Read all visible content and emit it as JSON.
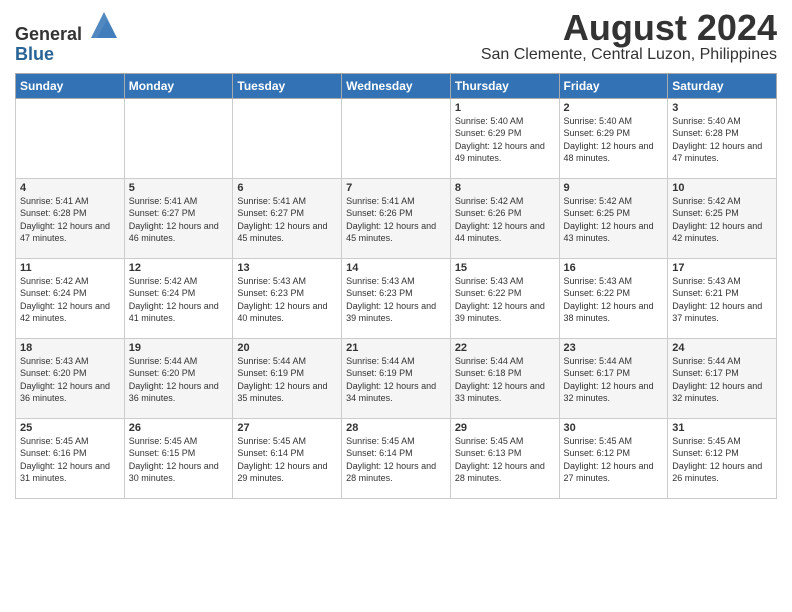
{
  "logo": {
    "general": "General",
    "blue": "Blue"
  },
  "title": {
    "month_year": "August 2024",
    "location": "San Clemente, Central Luzon, Philippines"
  },
  "headers": [
    "Sunday",
    "Monday",
    "Tuesday",
    "Wednesday",
    "Thursday",
    "Friday",
    "Saturday"
  ],
  "weeks": [
    [
      {
        "day": "",
        "sunrise": "",
        "sunset": "",
        "daylight": ""
      },
      {
        "day": "",
        "sunrise": "",
        "sunset": "",
        "daylight": ""
      },
      {
        "day": "",
        "sunrise": "",
        "sunset": "",
        "daylight": ""
      },
      {
        "day": "",
        "sunrise": "",
        "sunset": "",
        "daylight": ""
      },
      {
        "day": "1",
        "sunrise": "Sunrise: 5:40 AM",
        "sunset": "Sunset: 6:29 PM",
        "daylight": "Daylight: 12 hours and 49 minutes."
      },
      {
        "day": "2",
        "sunrise": "Sunrise: 5:40 AM",
        "sunset": "Sunset: 6:29 PM",
        "daylight": "Daylight: 12 hours and 48 minutes."
      },
      {
        "day": "3",
        "sunrise": "Sunrise: 5:40 AM",
        "sunset": "Sunset: 6:28 PM",
        "daylight": "Daylight: 12 hours and 47 minutes."
      }
    ],
    [
      {
        "day": "4",
        "sunrise": "Sunrise: 5:41 AM",
        "sunset": "Sunset: 6:28 PM",
        "daylight": "Daylight: 12 hours and 47 minutes."
      },
      {
        "day": "5",
        "sunrise": "Sunrise: 5:41 AM",
        "sunset": "Sunset: 6:27 PM",
        "daylight": "Daylight: 12 hours and 46 minutes."
      },
      {
        "day": "6",
        "sunrise": "Sunrise: 5:41 AM",
        "sunset": "Sunset: 6:27 PM",
        "daylight": "Daylight: 12 hours and 45 minutes."
      },
      {
        "day": "7",
        "sunrise": "Sunrise: 5:41 AM",
        "sunset": "Sunset: 6:26 PM",
        "daylight": "Daylight: 12 hours and 45 minutes."
      },
      {
        "day": "8",
        "sunrise": "Sunrise: 5:42 AM",
        "sunset": "Sunset: 6:26 PM",
        "daylight": "Daylight: 12 hours and 44 minutes."
      },
      {
        "day": "9",
        "sunrise": "Sunrise: 5:42 AM",
        "sunset": "Sunset: 6:25 PM",
        "daylight": "Daylight: 12 hours and 43 minutes."
      },
      {
        "day": "10",
        "sunrise": "Sunrise: 5:42 AM",
        "sunset": "Sunset: 6:25 PM",
        "daylight": "Daylight: 12 hours and 42 minutes."
      }
    ],
    [
      {
        "day": "11",
        "sunrise": "Sunrise: 5:42 AM",
        "sunset": "Sunset: 6:24 PM",
        "daylight": "Daylight: 12 hours and 42 minutes."
      },
      {
        "day": "12",
        "sunrise": "Sunrise: 5:42 AM",
        "sunset": "Sunset: 6:24 PM",
        "daylight": "Daylight: 12 hours and 41 minutes."
      },
      {
        "day": "13",
        "sunrise": "Sunrise: 5:43 AM",
        "sunset": "Sunset: 6:23 PM",
        "daylight": "Daylight: 12 hours and 40 minutes."
      },
      {
        "day": "14",
        "sunrise": "Sunrise: 5:43 AM",
        "sunset": "Sunset: 6:23 PM",
        "daylight": "Daylight: 12 hours and 39 minutes."
      },
      {
        "day": "15",
        "sunrise": "Sunrise: 5:43 AM",
        "sunset": "Sunset: 6:22 PM",
        "daylight": "Daylight: 12 hours and 39 minutes."
      },
      {
        "day": "16",
        "sunrise": "Sunrise: 5:43 AM",
        "sunset": "Sunset: 6:22 PM",
        "daylight": "Daylight: 12 hours and 38 minutes."
      },
      {
        "day": "17",
        "sunrise": "Sunrise: 5:43 AM",
        "sunset": "Sunset: 6:21 PM",
        "daylight": "Daylight: 12 hours and 37 minutes."
      }
    ],
    [
      {
        "day": "18",
        "sunrise": "Sunrise: 5:43 AM",
        "sunset": "Sunset: 6:20 PM",
        "daylight": "Daylight: 12 hours and 36 minutes."
      },
      {
        "day": "19",
        "sunrise": "Sunrise: 5:44 AM",
        "sunset": "Sunset: 6:20 PM",
        "daylight": "Daylight: 12 hours and 36 minutes."
      },
      {
        "day": "20",
        "sunrise": "Sunrise: 5:44 AM",
        "sunset": "Sunset: 6:19 PM",
        "daylight": "Daylight: 12 hours and 35 minutes."
      },
      {
        "day": "21",
        "sunrise": "Sunrise: 5:44 AM",
        "sunset": "Sunset: 6:19 PM",
        "daylight": "Daylight: 12 hours and 34 minutes."
      },
      {
        "day": "22",
        "sunrise": "Sunrise: 5:44 AM",
        "sunset": "Sunset: 6:18 PM",
        "daylight": "Daylight: 12 hours and 33 minutes."
      },
      {
        "day": "23",
        "sunrise": "Sunrise: 5:44 AM",
        "sunset": "Sunset: 6:17 PM",
        "daylight": "Daylight: 12 hours and 32 minutes."
      },
      {
        "day": "24",
        "sunrise": "Sunrise: 5:44 AM",
        "sunset": "Sunset: 6:17 PM",
        "daylight": "Daylight: 12 hours and 32 minutes."
      }
    ],
    [
      {
        "day": "25",
        "sunrise": "Sunrise: 5:45 AM",
        "sunset": "Sunset: 6:16 PM",
        "daylight": "Daylight: 12 hours and 31 minutes."
      },
      {
        "day": "26",
        "sunrise": "Sunrise: 5:45 AM",
        "sunset": "Sunset: 6:15 PM",
        "daylight": "Daylight: 12 hours and 30 minutes."
      },
      {
        "day": "27",
        "sunrise": "Sunrise: 5:45 AM",
        "sunset": "Sunset: 6:14 PM",
        "daylight": "Daylight: 12 hours and 29 minutes."
      },
      {
        "day": "28",
        "sunrise": "Sunrise: 5:45 AM",
        "sunset": "Sunset: 6:14 PM",
        "daylight": "Daylight: 12 hours and 28 minutes."
      },
      {
        "day": "29",
        "sunrise": "Sunrise: 5:45 AM",
        "sunset": "Sunset: 6:13 PM",
        "daylight": "Daylight: 12 hours and 28 minutes."
      },
      {
        "day": "30",
        "sunrise": "Sunrise: 5:45 AM",
        "sunset": "Sunset: 6:12 PM",
        "daylight": "Daylight: 12 hours and 27 minutes."
      },
      {
        "day": "31",
        "sunrise": "Sunrise: 5:45 AM",
        "sunset": "Sunset: 6:12 PM",
        "daylight": "Daylight: 12 hours and 26 minutes."
      }
    ]
  ]
}
